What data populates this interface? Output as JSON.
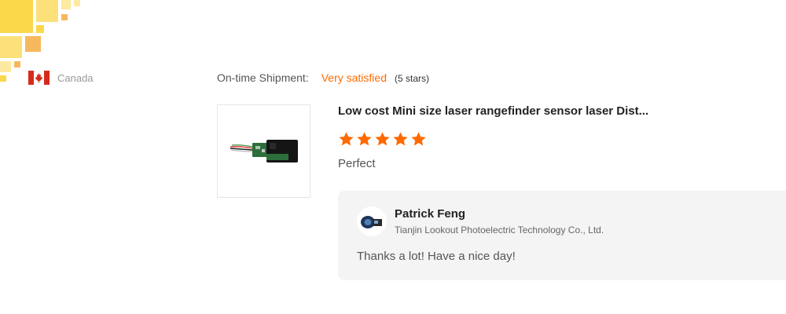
{
  "buyer": {
    "country": "Canada",
    "country_flag_icon": "canada-flag-icon"
  },
  "shipment": {
    "label": "On-time Shipment:",
    "rating_text": "Very satisfied",
    "stars_text": "(5 stars)"
  },
  "product": {
    "title": "Low cost Mini size laser rangefinder sensor laser Dist...",
    "image_icon": "laser-sensor-product-image",
    "rating": 5,
    "rating_max": 5,
    "review": "Perfect"
  },
  "reply": {
    "name": "Patrick Feng",
    "company": "Tianjin Lookout Photoelectric Technology Co., Ltd.",
    "message": "Thanks a lot! Have a nice day!",
    "avatar_icon": "seller-avatar"
  },
  "colors": {
    "accent": "#ff6a00",
    "star": "#ff6a00",
    "reply_bg": "#f4f4f4",
    "deco": [
      "#fbd84a",
      "#fce17a",
      "#f6b85e",
      "#fde9a0"
    ]
  }
}
